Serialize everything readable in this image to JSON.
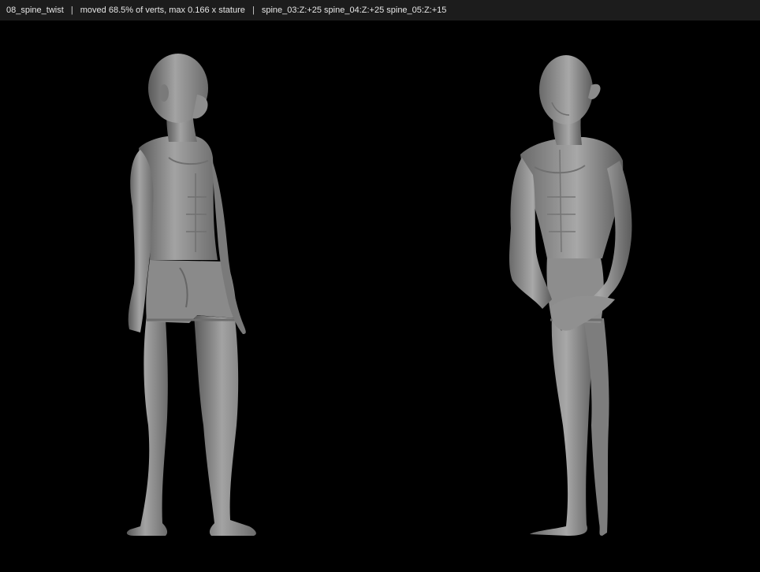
{
  "status_bar": {
    "case_name": "08_spine_twist",
    "separator": "|",
    "stats": "moved 68.5% of verts, max 0.166 x stature",
    "rotations": "spine_03:Z:+25 spine_04:Z:+25 spine_05:Z:+15"
  },
  "viewport": {
    "background": "#000000",
    "mesh_color": "#8d8d8d",
    "figures": [
      {
        "view": "three-quarter left"
      },
      {
        "view": "three-quarter right"
      }
    ]
  }
}
